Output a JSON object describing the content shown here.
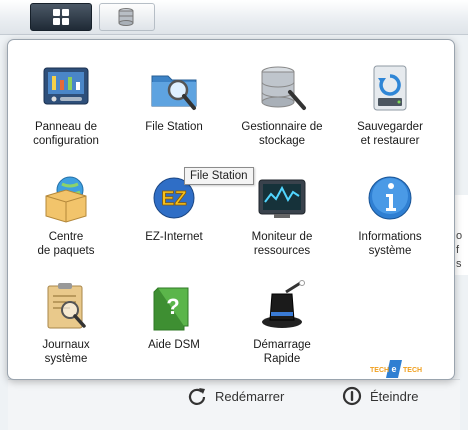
{
  "taskbar": {
    "main_menu_icon": "grid-icon",
    "storage_icon": "storage-icon"
  },
  "apps": [
    {
      "label": "Panneau de\nconfiguration",
      "icon": "control-panel-icon"
    },
    {
      "label": "File Station",
      "icon": "file-station-icon"
    },
    {
      "label": "Gestionnaire de\nstockage",
      "icon": "storage-manager-icon"
    },
    {
      "label": "Sauvegarder\net restaurer",
      "icon": "backup-icon"
    },
    {
      "label": "Centre\nde paquets",
      "icon": "package-center-icon"
    },
    {
      "label": "EZ-Internet",
      "icon": "ez-internet-icon"
    },
    {
      "label": "Moniteur de\nressources",
      "icon": "resource-monitor-icon"
    },
    {
      "label": "Informations\nsystème",
      "icon": "info-icon"
    },
    {
      "label": "Journaux\nsystème",
      "icon": "logs-icon"
    },
    {
      "label": "Aide DSM",
      "icon": "help-icon"
    },
    {
      "label": "Démarrage\nRapide",
      "icon": "quick-start-icon"
    }
  ],
  "tooltip": "File Station",
  "actions": {
    "restart": "Redémarrer",
    "shutdown": "Éteindre"
  },
  "background": {
    "right_fragments": [
      "o",
      "f",
      "s"
    ]
  },
  "watermark": "TECH TECH"
}
